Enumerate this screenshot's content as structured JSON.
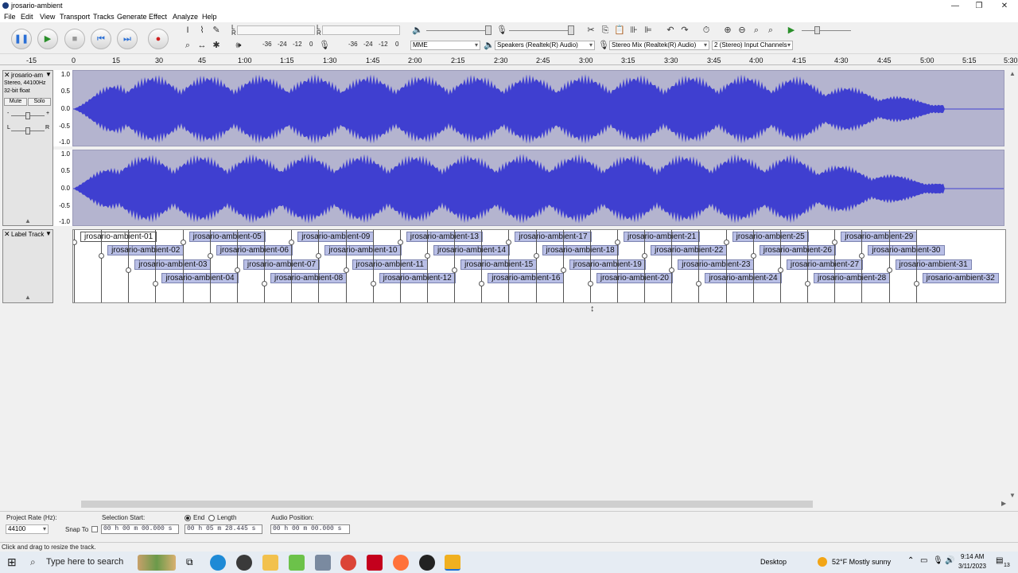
{
  "window": {
    "title": "jrosario-ambient",
    "minimize": "—",
    "maximize": "❐",
    "close": "✕"
  },
  "menu": [
    "File",
    "Edit",
    "View",
    "Transport",
    "Tracks",
    "Generate",
    "Effect",
    "Analyze",
    "Help"
  ],
  "meters": {
    "record_scale": [
      "-36",
      "-24",
      "-12",
      "0"
    ],
    "playback_scale": [
      "-36",
      "-24",
      "-12",
      "0"
    ],
    "record_lr": [
      "L",
      "R"
    ],
    "playback_lr": [
      "L",
      "R"
    ]
  },
  "devices": {
    "host": "MME",
    "playback": "Speakers (Realtek(R) Audio)",
    "recording": "Stereo Mix (Realtek(R) Audio)",
    "channels": "2 (Stereo) Input Channels"
  },
  "ruler": [
    "-15",
    "0",
    "15",
    "30",
    "45",
    "1:00",
    "1:15",
    "1:30",
    "1:45",
    "2:00",
    "2:15",
    "2:30",
    "2:45",
    "3:00",
    "3:15",
    "3:30",
    "3:45",
    "4:00",
    "4:15",
    "4:30",
    "4:45",
    "5:00",
    "5:15",
    "5:30"
  ],
  "audio_track": {
    "name": "jrosario-am",
    "info1": "Stereo, 44100Hz",
    "info2": "32-bit float",
    "mute": "Mute",
    "solo": "Solo",
    "gain_marks": [
      "-",
      "+"
    ],
    "pan_marks": [
      "L",
      "R"
    ],
    "scale": [
      "1.0",
      "0.5",
      "0.0",
      "-0.5",
      "-1.0"
    ]
  },
  "label_track": {
    "name": "Label Track",
    "labels": [
      "jrosario-ambient-01",
      "jrosario-ambient-02",
      "jrosario-ambient-03",
      "jrosario-ambient-04",
      "jrosario-ambient-05",
      "jrosario-ambient-06",
      "jrosario-ambient-07",
      "jrosario-ambient-08",
      "jrosario-ambient-09",
      "jrosario-ambient-10",
      "jrosario-ambient-11",
      "jrosario-ambient-12",
      "jrosario-ambient-13",
      "jrosario-ambient-14",
      "jrosario-ambient-15",
      "jrosario-ambient-16",
      "jrosario-ambient-17",
      "jrosario-ambient-18",
      "jrosario-ambient-19",
      "jrosario-ambient-20",
      "jrosario-ambient-21",
      "jrosario-ambient-22",
      "jrosario-ambient-23",
      "jrosario-ambient-24",
      "jrosario-ambient-25",
      "jrosario-ambient-26",
      "jrosario-ambient-27",
      "jrosario-ambient-28",
      "jrosario-ambient-29",
      "jrosario-ambient-30",
      "jrosario-ambient-31",
      "jrosario-ambient-32"
    ]
  },
  "bottom": {
    "project_rate_label": "Project Rate (Hz):",
    "project_rate": "44100",
    "snap_to": "Snap To",
    "selection_start_label": "Selection Start:",
    "selection_start": "00 h 00 m 00.000 s",
    "end_label": "End",
    "length_label": "Length",
    "selection_end": "00 h 05 m 28.445 s",
    "audio_position_label": "Audio Position:",
    "audio_position": "00 h 00 m 00.000 s"
  },
  "status": "Click and drag to resize the track.",
  "taskbar": {
    "search_placeholder": "Type here to search",
    "desktop": "Desktop",
    "weather": "52°F  Mostly sunny",
    "time": "9:14 AM",
    "date": "3/11/2023",
    "notifications": "13"
  },
  "colors": {
    "waveform": "#3f3fd0",
    "clip_background": "#b4b4cf",
    "label_fill": "#b9bfe6",
    "selection": "#ffffff"
  }
}
